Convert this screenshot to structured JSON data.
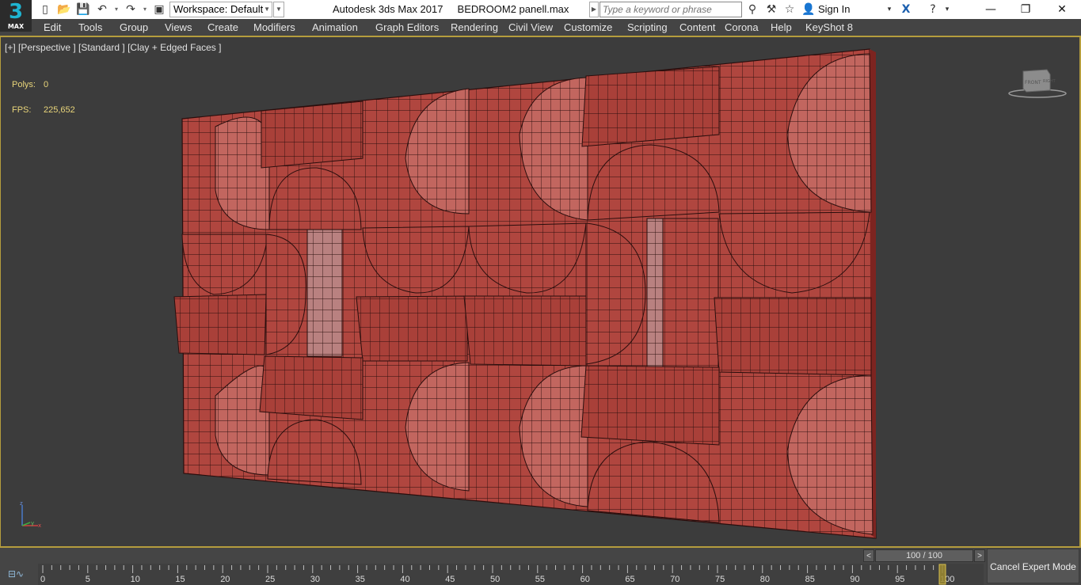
{
  "app": {
    "logo_big": "3",
    "logo_small": "MAX"
  },
  "title": {
    "workspace_label": "Workspace: Default",
    "window_title": "Autodesk 3ds Max 2017     BEDROOM2 panell.max",
    "search_placeholder": "Type a keyword or phrase",
    "sign_in": "Sign In"
  },
  "menu": [
    "Edit",
    "Tools",
    "Group",
    "Views",
    "Create",
    "Modifiers",
    "Animation",
    "Graph Editors",
    "Rendering",
    "Civil View",
    "Customize",
    "Scripting",
    "Content",
    "Corona",
    "Help",
    "KeyShot 8"
  ],
  "viewport": {
    "label": "[+] [Perspective ] [Standard ] [Clay + Edged Faces ]",
    "polys_label": "Polys:",
    "polys_value": "0",
    "fps_label": "FPS:",
    "fps_value": "225,652",
    "viewcube_label": "FRONT",
    "viewcube_right": "RIGHT",
    "axis_z": "z",
    "axis_y": "y",
    "axis_x": "x"
  },
  "timeline": {
    "frame_display": "100 / 100",
    "ticks": [
      "0",
      "5",
      "10",
      "15",
      "20",
      "25",
      "30",
      "35",
      "40",
      "45",
      "50",
      "55",
      "60",
      "65",
      "70",
      "75",
      "80",
      "85",
      "90",
      "95",
      "100"
    ],
    "current_frame": 100,
    "cancel_expert": "Cancel Expert Mode"
  },
  "colors": {
    "viewport_bg": "#3c3c3c",
    "panel": "#b04a42",
    "panel_dark": "#7d2420",
    "wire": "#2a0e0d",
    "accent": "#b59d3d"
  }
}
